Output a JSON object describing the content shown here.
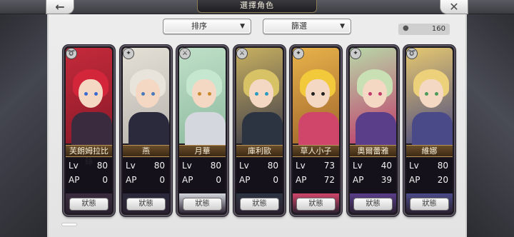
{
  "header": {
    "title": "選擇角色",
    "back_icon": "arrow-left-icon",
    "close_icon": "close-icon"
  },
  "toolbar": {
    "sort_label": "排序",
    "filter_label": "篩選",
    "count": "160",
    "count_icon": "user-icon"
  },
  "colors": {
    "name_plate": "#4e3820",
    "card_frame": "#5a5560",
    "stats_bg": "#14101a"
  },
  "labels": {
    "lv": "Lv",
    "ap": "AP",
    "status_button": "狀態"
  },
  "characters": [
    {
      "name": "芙朗姆拉比絲",
      "lv": "80",
      "ap": "0",
      "weapon": "whip-icon",
      "art": [
        "#c42a3a",
        "#8a1a2a"
      ],
      "outfit": "#3a2c3e",
      "hair": "#d3263a",
      "eye": "#3a6ad0"
    },
    {
      "name": "燕",
      "lv": "80",
      "ap": "0",
      "weapon": "claw-icon",
      "art": [
        "#e5e0d6",
        "#b8b4ae"
      ],
      "outfit": "#2a2a3c",
      "hair": "#e8e4dc",
      "eye": "#4a7ab8"
    },
    {
      "name": "月華",
      "lv": "80",
      "ap": "0",
      "weapon": "sword-icon",
      "art": [
        "#bfe0c8",
        "#8fbba0"
      ],
      "outfit": "#d4d8de",
      "hair": "#c5e6cf",
      "eye": "#c88a2a"
    },
    {
      "name": "庫利歐",
      "lv": "80",
      "ap": "0",
      "weapon": "sword-icon",
      "art": [
        "#c8b060",
        "#3e3c4a"
      ],
      "outfit": "#2c3442",
      "hair": "#d8c266",
      "eye": "#2a9ac0"
    },
    {
      "name": "草人小子",
      "lv": "73",
      "ap": "72",
      "weapon": "claw-icon",
      "art": [
        "#e8b24a",
        "#a0662c"
      ],
      "outfit": "#d0466a",
      "hair": "#f2c93a",
      "eye": "#222222"
    },
    {
      "name": "奧爾蕾雅",
      "lv": "40",
      "ap": "39",
      "weapon": "claw-icon",
      "art": [
        "#b8d8a8",
        "#c03a6a"
      ],
      "outfit": "#5a3e8a",
      "hair": "#c8e0b4",
      "eye": "#c03a6a"
    },
    {
      "name": "維娜",
      "lv": "80",
      "ap": "20",
      "weapon": "whip-icon",
      "art": [
        "#e6c870",
        "#4a4a80"
      ],
      "outfit": "#4a4a88",
      "hair": "#ecd07a",
      "eye": "#4a9a5a"
    }
  ]
}
